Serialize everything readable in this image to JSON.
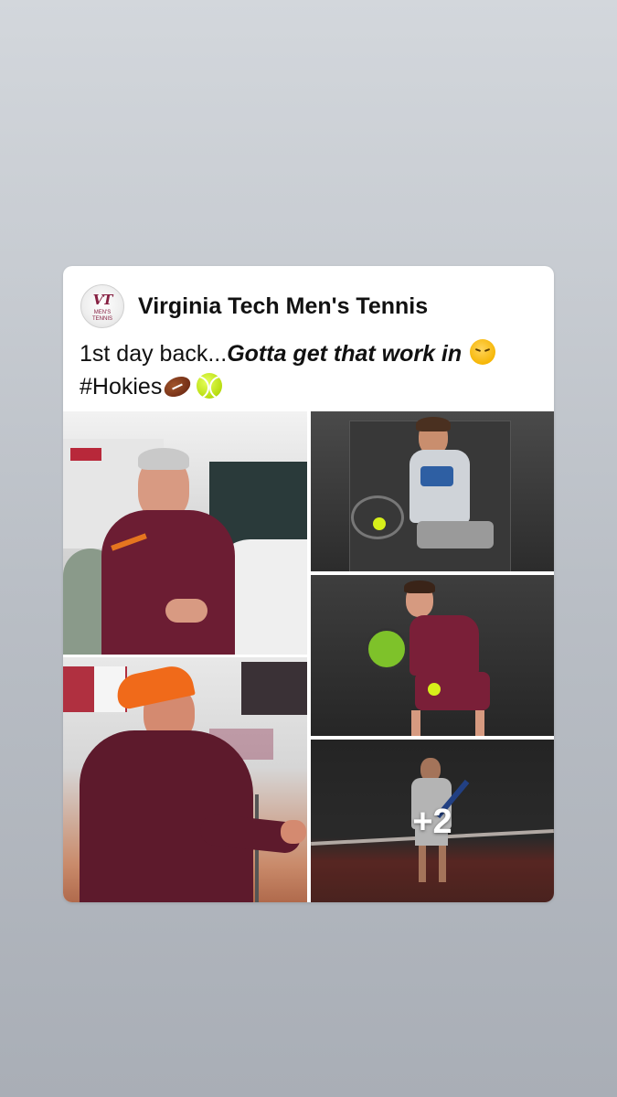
{
  "post": {
    "author": {
      "name": "Virginia Tech Men's Tennis",
      "avatar_logo": {
        "monogram": "VT",
        "line1": "MEN'S",
        "line2": "TENNIS"
      }
    },
    "caption": {
      "text_lead": "1st day back...",
      "text_emphasis": "Gotta get that work in",
      "hashtag": "#Hokies",
      "emoji_icons": [
        "huffing-face-emoji",
        "football-emoji",
        "tennis-ball-emoji"
      ]
    },
    "photos": [
      {
        "subject": "coach-talking"
      },
      {
        "subject": "player-forehand-gray-shirt"
      },
      {
        "subject": "player-forehand-maroon-shirt"
      },
      {
        "subject": "coach-orange-cap"
      },
      {
        "subject": "player-on-court"
      }
    ],
    "more_photos_label": "+2"
  },
  "colors": {
    "maroon": "#861f41",
    "orange": "#e5751f",
    "card_bg": "#ffffff"
  }
}
